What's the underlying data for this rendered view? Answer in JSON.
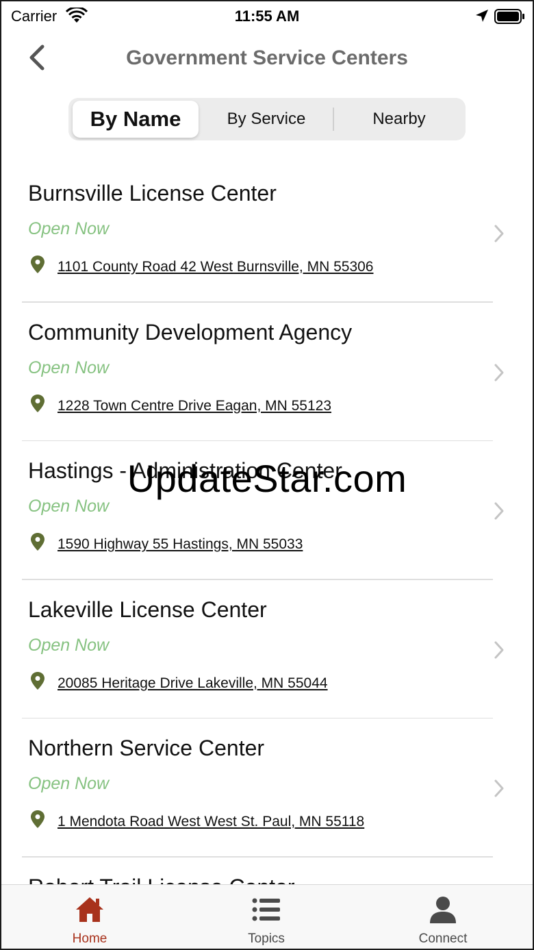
{
  "status_bar": {
    "carrier": "Carrier",
    "time": "11:55 AM"
  },
  "nav": {
    "title": "Government Service Centers"
  },
  "segments": [
    {
      "label": "By Name",
      "active": true
    },
    {
      "label": "By Service",
      "active": false
    },
    {
      "label": "Nearby",
      "active": false
    }
  ],
  "centers": [
    {
      "name": "Burnsville License Center",
      "status": "Open Now",
      "address": "1101 County Road 42 West Burnsville, MN 55306"
    },
    {
      "name": "Community Development Agency",
      "status": "Open Now",
      "address": "1228 Town Centre Drive Eagan, MN 55123"
    },
    {
      "name": "Hastings - Administration Center",
      "status": "Open Now",
      "address": "1590 Highway 55 Hastings, MN 55033"
    },
    {
      "name": "Lakeville License Center",
      "status": "Open Now",
      "address": "20085 Heritage Drive Lakeville, MN 55044"
    },
    {
      "name": "Northern Service Center",
      "status": "Open Now",
      "address": "1 Mendota Road West West St. Paul, MN 55118"
    },
    {
      "name": "Robert Trail License Center",
      "status": "",
      "address": ""
    }
  ],
  "watermark": "UpdateStar.com",
  "tabs": [
    {
      "label": "Home",
      "icon": "home-icon",
      "active": true
    },
    {
      "label": "Topics",
      "icon": "list-icon",
      "active": false
    },
    {
      "label": "Connect",
      "icon": "person-icon",
      "active": false
    }
  ],
  "colors": {
    "accent": "#a8321c",
    "open_status": "#86c281",
    "pin": "#5f6e34"
  }
}
